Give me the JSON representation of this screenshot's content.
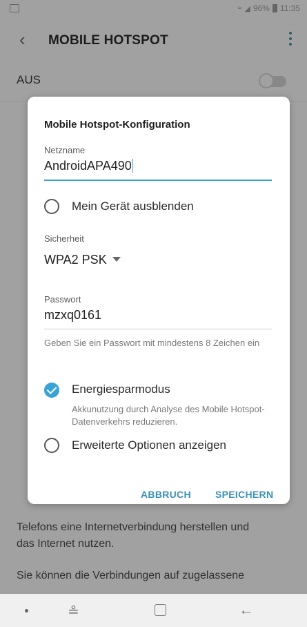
{
  "status_bar": {
    "battery_text": "96%",
    "time": "11:35"
  },
  "app_bar": {
    "title": "MOBILE HOTSPOT"
  },
  "master_switch": {
    "label": "AUS",
    "on": false
  },
  "background_text": {
    "line1": "Telefons eine Internetverbindung herstellen und",
    "line2": "das Internet nutzen.",
    "line3": "Sie können die Verbindungen auf zugelassene"
  },
  "dialog": {
    "title": "Mobile Hotspot-Konfiguration",
    "network_name": {
      "label": "Netzname",
      "value": "AndroidAPA490"
    },
    "hide_device": {
      "label": "Mein Gerät ausblenden",
      "checked": false
    },
    "security": {
      "label": "Sicherheit",
      "value": "WPA2 PSK"
    },
    "password": {
      "label": "Passwort",
      "value": "mzxq0161",
      "hint": "Geben Sie ein Passwort mit mindestens 8 Zeichen ein"
    },
    "power_saving": {
      "label": "Energiesparmodus",
      "description": "Akkunutzung durch Analyse des Mobile Hotspot-Datenverkehrs reduzieren.",
      "checked": true
    },
    "advanced": {
      "label": "Erweiterte Optionen anzeigen",
      "checked": false
    },
    "cancel_label": "ABBRUCH",
    "save_label": "SPEICHERN"
  },
  "colors": {
    "accent": "#3aa3d6",
    "button_text": "#3a8fb7",
    "more_icon": "#4a8f9a"
  },
  "icons": {
    "back": "back-arrow-icon",
    "more": "more-vert-icon",
    "nav_recents": "recents-icon",
    "nav_home": "home-icon",
    "nav_back": "nav-back-icon"
  }
}
